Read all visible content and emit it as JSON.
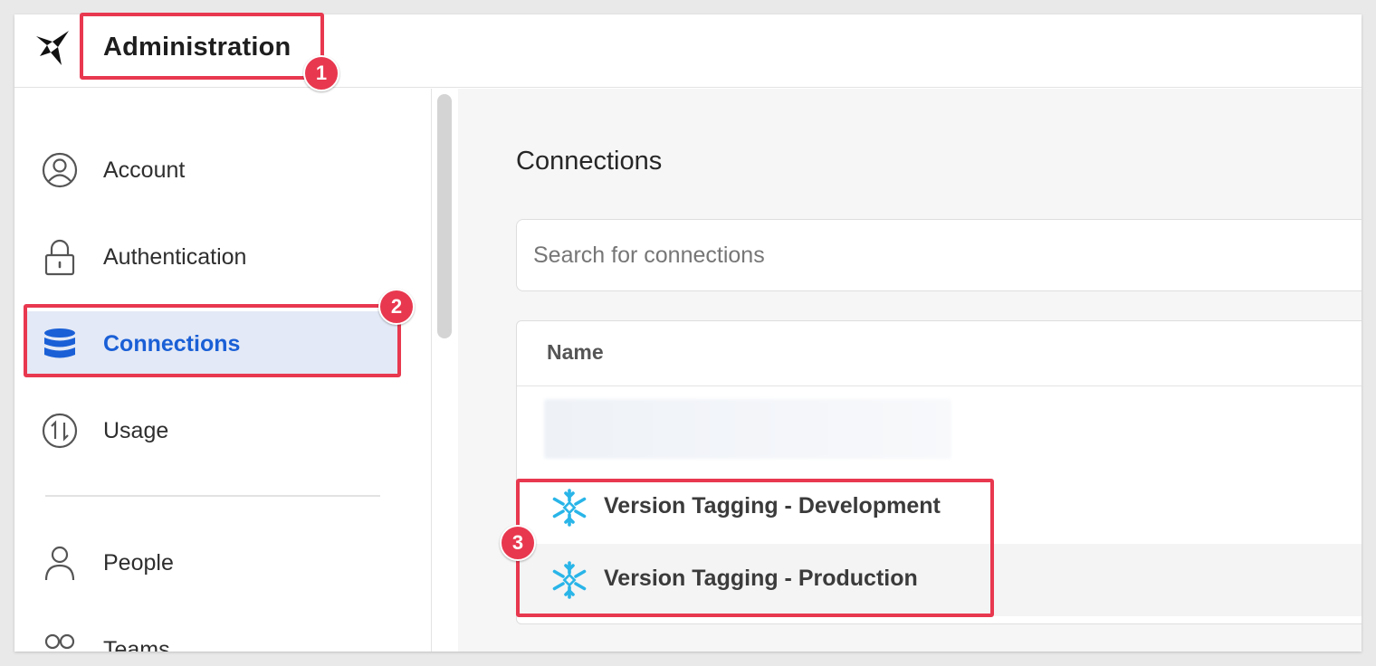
{
  "header": {
    "title": "Administration"
  },
  "sidebar": {
    "items": [
      {
        "label": "Account",
        "icon": "user-circle-icon"
      },
      {
        "label": "Authentication",
        "icon": "lock-icon"
      },
      {
        "label": "Connections",
        "icon": "database-icon",
        "active": true
      },
      {
        "label": "Usage",
        "icon": "usage-arrows-icon"
      },
      {
        "label": "People",
        "icon": "person-icon"
      },
      {
        "label": "Teams",
        "icon": "team-icon"
      }
    ]
  },
  "main": {
    "title": "Connections",
    "search": {
      "placeholder": "Search for connections",
      "value": ""
    },
    "table": {
      "columns": [
        "Name"
      ],
      "rows": [
        {
          "name": "Version Tagging - Development",
          "icon": "snowflake-icon"
        },
        {
          "name": "Version Tagging - Production",
          "icon": "snowflake-icon"
        }
      ]
    }
  },
  "annotations": {
    "badges": [
      "1",
      "2",
      "3"
    ]
  },
  "colors": {
    "accent": "#1a5fd6",
    "active_bg": "#e3e9f6",
    "highlight": "#e8384f",
    "snowflake": "#29b5e8"
  }
}
